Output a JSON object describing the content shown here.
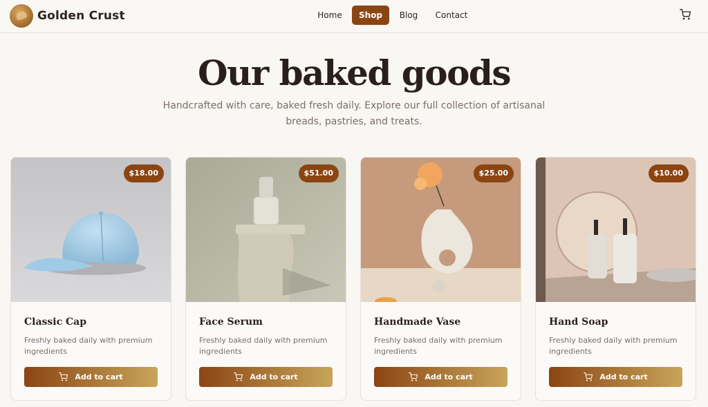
{
  "brand": {
    "name": "Golden Crust",
    "logo_icon": "croissant-logo-icon"
  },
  "nav": {
    "items": [
      "Home",
      "Shop",
      "Blog",
      "Contact"
    ],
    "active": "Shop",
    "cart_icon": "cart-icon"
  },
  "colors": {
    "accent": "#8b4513",
    "gradient_end": "#c8a55a",
    "background": "#f9f7f4"
  },
  "hero": {
    "title": "Our baked goods",
    "subtitle": "Handcrafted with care, baked fresh daily. Explore our full collection of artisanal breads, pastries, and treats."
  },
  "products": [
    {
      "name": "Classic Cap",
      "price": "$18.00",
      "description": "Freshly baked daily with premium ingredients",
      "button": "Add to cart"
    },
    {
      "name": "Face Serum",
      "price": "$51.00",
      "description": "Freshly baked daily with premium ingredients",
      "button": "Add to cart"
    },
    {
      "name": "Handmade Vase",
      "price": "$25.00",
      "description": "Freshly baked daily with premium ingredients",
      "button": "Add to cart"
    },
    {
      "name": "Hand Soap",
      "price": "$10.00",
      "description": "Freshly baked daily with premium ingredients",
      "button": "Add to cart"
    }
  ]
}
